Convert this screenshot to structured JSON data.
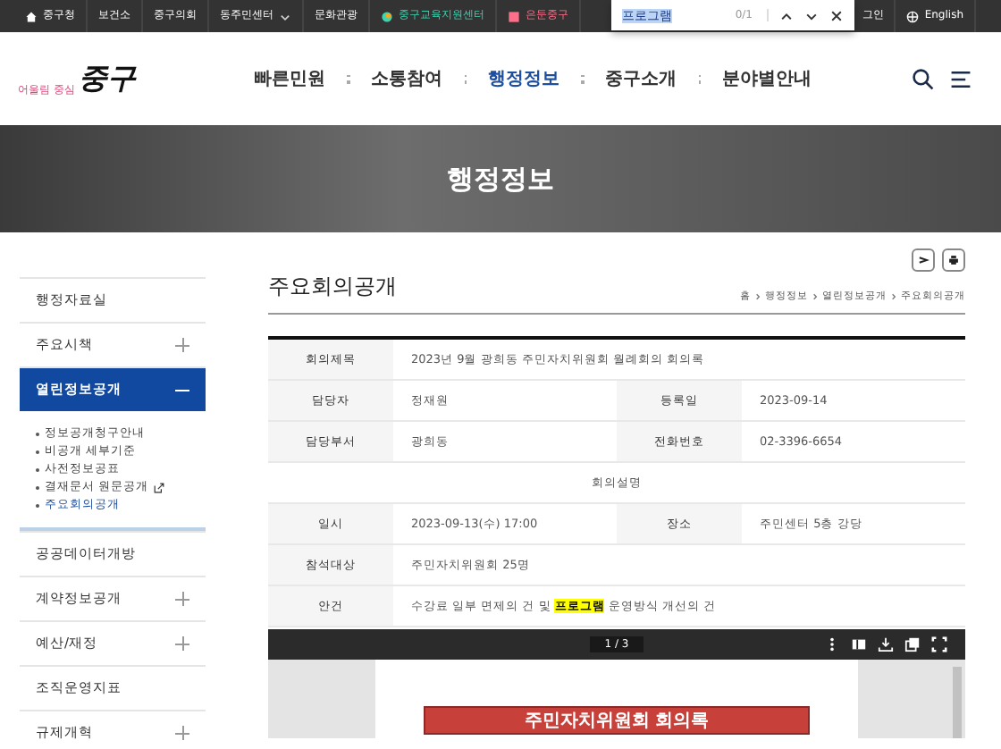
{
  "top_bar": {
    "links": [
      {
        "label": "중구청",
        "kind": "home"
      },
      {
        "label": "보건소",
        "kind": "plain"
      },
      {
        "label": "중구의회",
        "kind": "plain"
      },
      {
        "label": "동주민센터",
        "kind": "dropdown"
      },
      {
        "label": "문화관광",
        "kind": "plain"
      },
      {
        "label": "중구교육지원센터",
        "kind": "edu",
        "color": "#3fd3b0"
      },
      {
        "label": "은둔중구",
        "kind": "hidden",
        "color": "#ff6f8a"
      }
    ],
    "login": "그인",
    "language": "English"
  },
  "find_bar": {
    "query": "프로그램",
    "count": "0/1"
  },
  "logo": {
    "slogan": "어울림 중심",
    "name": "중구"
  },
  "nav": [
    {
      "label": "빠른민원",
      "selected": false
    },
    {
      "label": "소통참여",
      "selected": false
    },
    {
      "label": "행정정보",
      "selected": true
    },
    {
      "label": "중구소개",
      "selected": false
    },
    {
      "label": "분야별안내",
      "selected": false
    }
  ],
  "banner": {
    "title": "행정정보"
  },
  "sidebar": {
    "items": [
      {
        "label": "행정자료실",
        "expandable": false,
        "selected": false
      },
      {
        "label": "주요시책",
        "expandable": true,
        "expanded": false,
        "selected": false
      },
      {
        "label": "열린정보공개",
        "expandable": true,
        "expanded": true,
        "selected": true,
        "children": [
          {
            "label": "정보공개청구안내",
            "external": false,
            "selected": false
          },
          {
            "label": "비공개 세부기준",
            "external": false,
            "selected": false
          },
          {
            "label": "사전정보공표",
            "external": false,
            "selected": false
          },
          {
            "label": "결재문서 원문공개",
            "external": true,
            "selected": false
          },
          {
            "label": "주요회의공개",
            "external": false,
            "selected": true
          }
        ]
      },
      {
        "label": "공공데이터개방",
        "expandable": false,
        "selected": false
      },
      {
        "label": "계약정보공개",
        "expandable": true,
        "expanded": false,
        "selected": false
      },
      {
        "label": "예산/재정",
        "expandable": true,
        "expanded": false,
        "selected": false
      },
      {
        "label": "조직운영지표",
        "expandable": false,
        "selected": false
      },
      {
        "label": "규제개혁",
        "expandable": true,
        "expanded": false,
        "selected": false
      }
    ]
  },
  "page": {
    "title": "주요회의공개",
    "breadcrumb": [
      "홈",
      "행정정보",
      "열린정보공개",
      "주요회의공개"
    ]
  },
  "info_rows": [
    [
      {
        "label": "회의제목",
        "value": "2023년 9월 광희동 주민자치위원회 월례회의 회의록"
      }
    ],
    [
      {
        "label": "담당자",
        "value": "정재원"
      },
      {
        "label": "등록일",
        "value": "2023-09-14"
      }
    ],
    [
      {
        "label": "담당부서",
        "value": "광희동"
      },
      {
        "label": "전화번호",
        "value": "02-3396-6654"
      }
    ]
  ],
  "section_heading": "회의설명",
  "detail_rows": [
    [
      {
        "label": "일시",
        "value": "2023-09-13(수) 17:00"
      },
      {
        "label": "장소",
        "value": "주민센터 5층 강당"
      }
    ],
    [
      {
        "label": "참석대상",
        "value": "주민자치위원회 25명"
      }
    ],
    [
      {
        "label": "안건",
        "value": "수강료 일부 면제의 건 및 **프로그램** 운영방식 개선의 건"
      }
    ]
  ],
  "pdf": {
    "page": "1 / 3",
    "heading": "주민자치위원회 회의록"
  }
}
